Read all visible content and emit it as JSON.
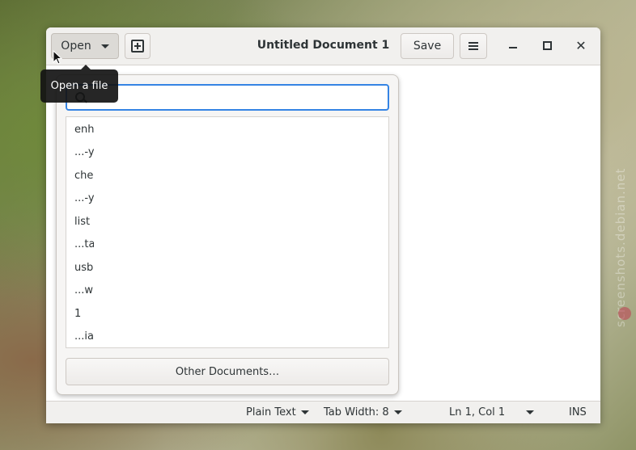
{
  "window": {
    "title": "Untitled Document 1"
  },
  "header": {
    "open_label": "Open",
    "save_label": "Save",
    "new_icon": "new-document-icon",
    "menu_icon": "hamburger-menu-icon"
  },
  "tooltip": {
    "text": "Open a file"
  },
  "popover": {
    "search_placeholder": "",
    "files": [
      {
        "name": "enh",
        "path": "...-y"
      },
      {
        "name": "che",
        "path": "...-y"
      },
      {
        "name": "list",
        "path": "...ta"
      },
      {
        "name": "usb",
        "path": "...w"
      },
      {
        "name": "1",
        "path": "...ia"
      }
    ],
    "other_label": "Other Documents…"
  },
  "statusbar": {
    "language": "Plain Text",
    "tab_width": "Tab Width: 8",
    "position": "Ln 1, Col 1",
    "mode": "INS"
  },
  "watermark": "screenshots.debian.net",
  "colors": {
    "accent": "#3584e4",
    "headerbar": "#f1f0ee",
    "tooltip": "#141414"
  }
}
